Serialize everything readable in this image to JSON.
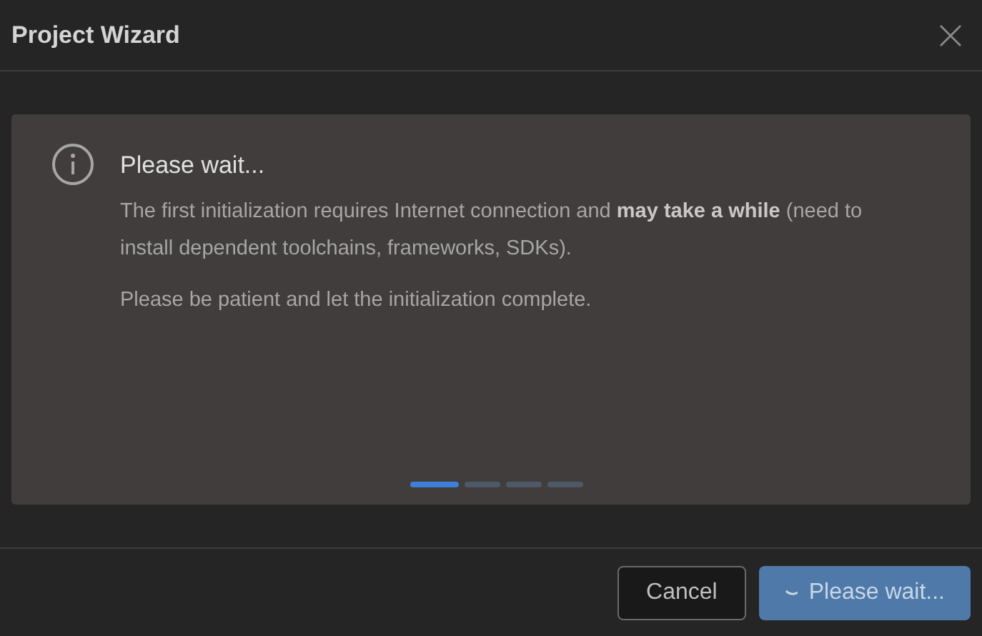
{
  "window": {
    "title": "Project Wizard"
  },
  "notice": {
    "heading": "Please wait...",
    "paragraphs": [
      "The first initialization requires Internet connection and **may take a while** (need to install dependent toolchains, frameworks, SDKs).",
      "Please be patient and let the initialization complete."
    ]
  },
  "pager": [
    {
      "selected": true
    },
    {
      "selected": false
    },
    {
      "selected": false
    },
    {
      "selected": false
    }
  ],
  "buttons": [
    {
      "label": "Cancel",
      "kind": "secondary",
      "busy": false
    },
    {
      "label": "Please wait...",
      "kind": "primary",
      "busy": true
    }
  ]
}
